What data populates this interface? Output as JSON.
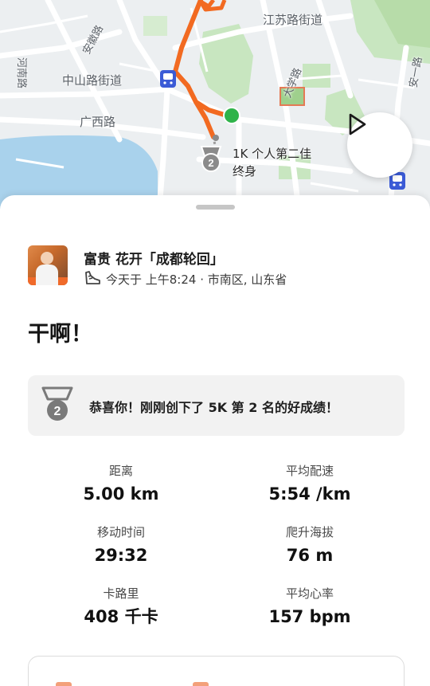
{
  "map": {
    "labels": {
      "jiangsu": "江苏路街道",
      "zhongshan": "中山路街道",
      "guangxi": "广西路",
      "anhui": "安徽路",
      "henan": "河南路",
      "daxue": "大学路",
      "anyi": "安一路"
    },
    "colors": {
      "route": "#f26a21",
      "start": "#2fb34a",
      "water": "#a9d2ec",
      "park": "#c8e6c0"
    }
  },
  "route_marker": {
    "medal_rank": "2",
    "label_line1": "1K 个人第二佳",
    "label_line2": "终身"
  },
  "activity": {
    "athlete": "富贵 花开「成都轮回」",
    "meta": "今天于 上午8:24 · 市南区, 山东省",
    "title": "干啊！",
    "achievement": {
      "rank": "2",
      "text": "恭喜你！刚刚创下了 5K 第 2 名的好成绩！"
    },
    "stats": [
      {
        "label": "距离",
        "value": "5.00 km"
      },
      {
        "label": "平均配速",
        "value": "5:54 /km"
      },
      {
        "label": "移动时间",
        "value": "29:32"
      },
      {
        "label": "爬升海拔",
        "value": "76 m"
      },
      {
        "label": "卡路里",
        "value": "408 千卡"
      },
      {
        "label": "平均心率",
        "value": "157 bpm"
      }
    ]
  },
  "icons": {
    "play": "play-icon",
    "shoe": "shoe-icon",
    "medal": "medal-icon",
    "transit": "transit-icon"
  }
}
